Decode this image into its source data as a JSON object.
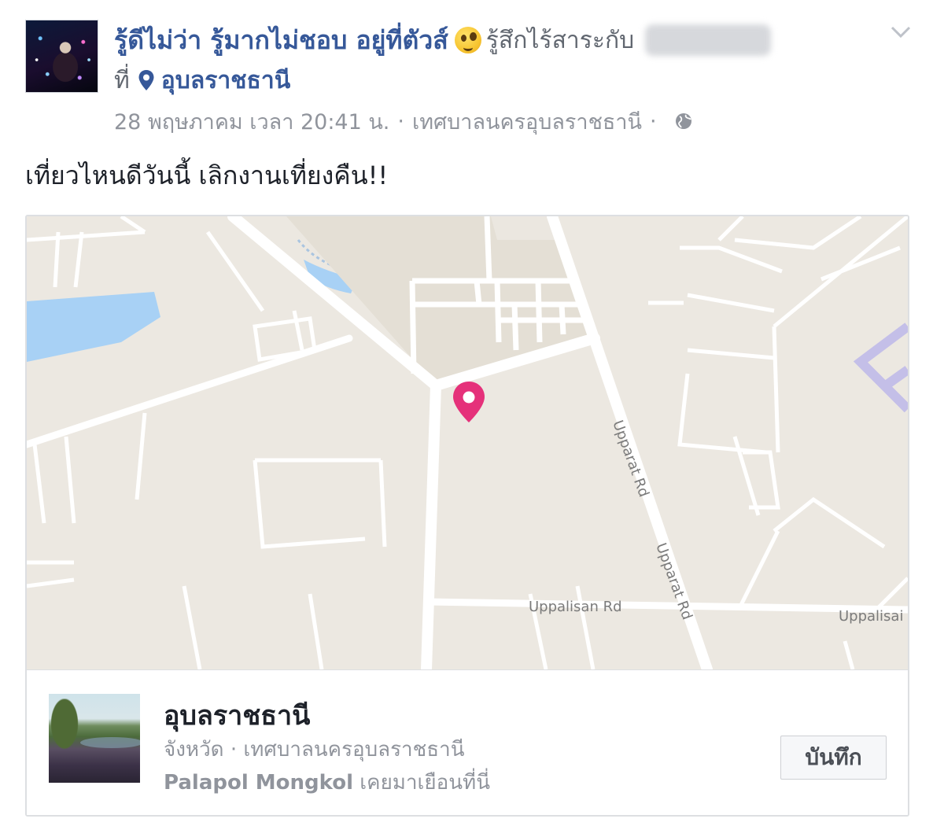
{
  "post": {
    "author": "รู้ดีไม่ว่า รู้มากไม่ชอบ อยู่ที่ตัวส์",
    "feeling": "รู้สึกไร้สาระกับ",
    "at_word": "ที่",
    "place": "อุบลราชธานี",
    "timestamp": "28 พฤษภาคม เวลา 20:41 น.",
    "location": "เทศบาลนครอุบลราชธานี",
    "separator": "·",
    "text": "เที่ยวไหนดีวันนี้ เลิกงานเที่ยงคืน!!"
  },
  "map": {
    "street_labels": [
      "Upparat Rd",
      "Upparat Rd",
      "Uppalisan Rd",
      "Uppalisai"
    ],
    "colors": {
      "land": "#ece8e1",
      "road": "#ffffff",
      "water": "#a8d1f5",
      "block": "#e2ddd3",
      "boundary": "#bdb7e6",
      "pin": "#e5317a"
    }
  },
  "place_card": {
    "title": "อุบลราชธานี",
    "subtitle": "จังหวัด · เทศบาลนครอุบลราชธานี",
    "visitor": "Palapol Mongkol",
    "visited_text": "เคยมาเยือนที่นี่",
    "save_label": "บันทึก"
  },
  "icons": {
    "pin": "map-pin-icon",
    "globe": "globe-icon",
    "chevron": "chevron-down-icon",
    "emoji": "feeling-emoji-icon"
  },
  "colors": {
    "link": "#365899",
    "secondary": "#90949c",
    "text": "#1d2129"
  }
}
